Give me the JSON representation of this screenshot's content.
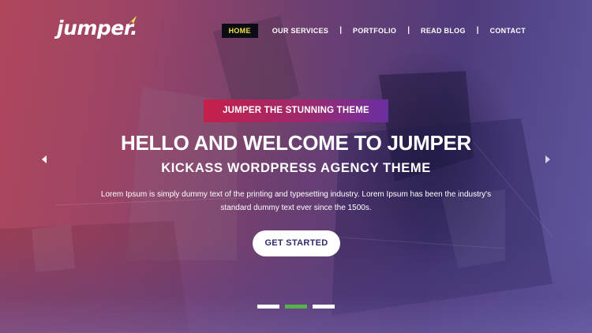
{
  "brand": {
    "logo_text": "jumper.",
    "accent_color": "#f0e442",
    "arrow_color": "#e9e24a"
  },
  "nav": {
    "items": [
      {
        "label": "HOME",
        "active": true
      },
      {
        "label": "OUR SERVICES",
        "active": false
      },
      {
        "label": "PORTFOLIO",
        "active": false
      },
      {
        "label": "READ BLOG",
        "active": false
      },
      {
        "label": "CONTACT",
        "active": false
      }
    ],
    "separator": "|",
    "active_bg": "#0c0c14"
  },
  "hero": {
    "badge": "JUMPER THE STUNNING THEME",
    "headline": "HELLO AND WELCOME TO JUMPER",
    "subheadline": "KICKASS WORDPRESS AGENCY THEME",
    "description_line1": "Lorem Ipsum is simply dummy text of the printing and typesetting industry. Lorem Ipsum has been the industry's",
    "description_line2": "standard dummy text ever since the 1500s.",
    "cta_label": "GET STARTED",
    "badge_gradient": [
      "#c5204a",
      "#6a2fa0"
    ]
  },
  "slider": {
    "prev_icon": "chevron-left-icon",
    "next_icon": "chevron-right-icon",
    "slide_count": 3,
    "active_index": 1,
    "active_color": "#55b24a"
  }
}
